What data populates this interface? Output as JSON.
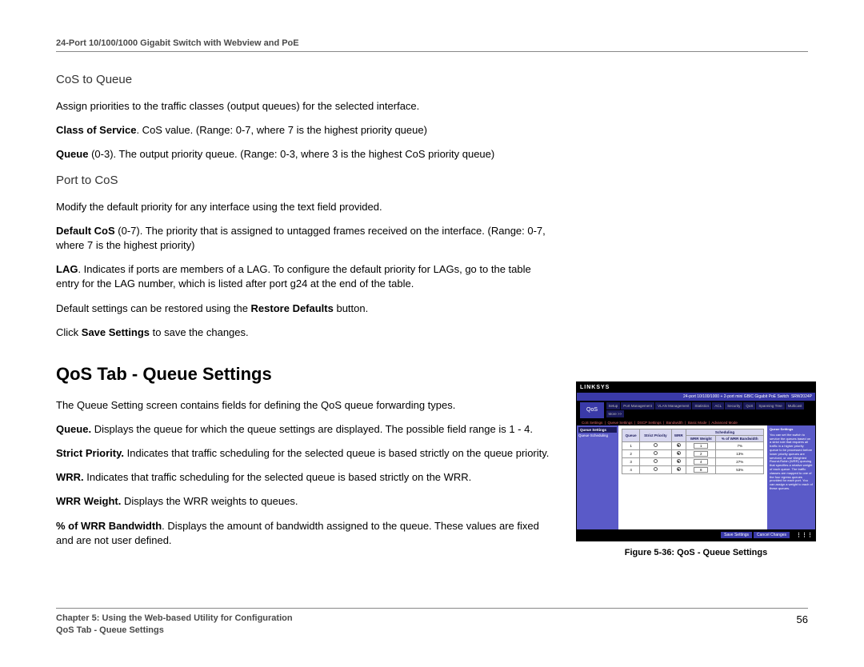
{
  "header": {
    "product": "24-Port 10/100/1000 Gigabit Switch with Webview and PoE"
  },
  "sections": {
    "cos_to_queue": {
      "title": "CoS to Queue",
      "intro": "Assign priorities to the traffic classes (output queues) for the selected interface.",
      "class_of_service_label": "Class of Service",
      "class_of_service_text": ". CoS value. (Range: 0-7, where 7 is the highest priority queue)",
      "queue_label": "Queue",
      "queue_text": " (0-3). The output priority queue. (Range: 0-3, where 3 is the highest CoS priority queue)"
    },
    "port_to_cos": {
      "title": "Port to CoS",
      "intro": "Modify the default priority for any interface using the text field provided.",
      "default_cos_label": "Default CoS",
      "default_cos_text": " (0-7). The priority that is assigned to untagged frames received on the interface. (Range: 0-7, where 7 is the highest priority)",
      "lag_label": "LAG",
      "lag_text": ". Indicates if ports are members of a LAG. To configure the default priority for LAGs, go to the table entry for the LAG number, which is listed after port g24 at the end of the table.",
      "restore_text_a": "Default settings can be restored using the ",
      "restore_label": "Restore Defaults",
      "restore_text_b": " button.",
      "save_text_a": "Click ",
      "save_label": "Save Settings",
      "save_text_b": " to save the changes."
    },
    "qos_queue": {
      "title": "QoS Tab - Queue Settings",
      "intro": "The Queue Setting screen contains fields for defining the QoS queue forwarding types.",
      "queue_label": "Queue.",
      "queue_text": " Displays the queue for which the queue settings are displayed. The possible field range is 1 - 4.",
      "strict_label": "Strict Priority.",
      "strict_text": " Indicates that traffic scheduling for the selected queue is based strictly on the queue priority.",
      "wrr_label": "WRR.",
      "wrr_text": " Indicates that traffic scheduling for the selected queue is based strictly on the WRR.",
      "wrr_weight_label": "WRR Weight.",
      "wrr_weight_text": " Displays the WRR weights to queues.",
      "bw_label": "% of WRR Bandwidth",
      "bw_text": ". Displays the amount of bandwidth assigned to the queue. These values are fixed and are not user defined."
    }
  },
  "figure": {
    "caption": "Figure 5-36: QoS - Queue Settings",
    "brand": "LINKSYS",
    "banner": "24-port 10/100/1000 + 2-port mini GBIC Gigabit PoE Switch",
    "model": "SRW2024P",
    "nav_current": "QoS",
    "tabs": [
      "Setup",
      "Port Management",
      "VLAN Management",
      "Statistics",
      "ACL",
      "Security",
      "QoS",
      "Spanning Tree",
      "Multicast",
      "More >>"
    ],
    "subnav": [
      "CoS Settings",
      "Queue Settings",
      "DSCP Settings",
      "Bandwidth",
      "Basic Mode",
      "Advanced Mode"
    ],
    "sidebar_hdr": "Queue Settings",
    "sidebar_item": "Queue Scheduling",
    "table_title": "Scheduling",
    "cols": [
      "Queue",
      "Strict Priority",
      "WRR",
      "WRR Weight",
      "% of WRR Bandwidth"
    ],
    "right_title": "Queue Settings",
    "right_text": "You can set the switch to service the queues based on a strict rule that requires all traffic in a higher priority queue to be processed before lower priority queues are serviced, or use Weighted Round-Robin (WRR) queuing that specifies a relative weight of each queue. The traffic classes are mapped to one of the four egress queues provided for each port. You can assign a weight to each of these queues.",
    "btn_save": "Save Settings",
    "btn_cancel": "Cancel Changes"
  },
  "chart_data": {
    "type": "table",
    "title": "Scheduling",
    "columns": [
      "Queue",
      "Strict Priority",
      "WRR",
      "WRR Weight",
      "% of WRR Bandwidth"
    ],
    "rows": [
      {
        "queue": 1,
        "strict": false,
        "wrr": true,
        "wrr_weight": 1,
        "pct": "7%"
      },
      {
        "queue": 2,
        "strict": false,
        "wrr": true,
        "wrr_weight": 2,
        "pct": "13%"
      },
      {
        "queue": 3,
        "strict": false,
        "wrr": true,
        "wrr_weight": 4,
        "pct": "27%"
      },
      {
        "queue": 4,
        "strict": false,
        "wrr": true,
        "wrr_weight": 8,
        "pct": "53%"
      }
    ]
  },
  "footer": {
    "chapter": "Chapter 5: Using the Web-based Utility for Configuration",
    "section": "QoS Tab - Queue Settings",
    "page": "56"
  }
}
